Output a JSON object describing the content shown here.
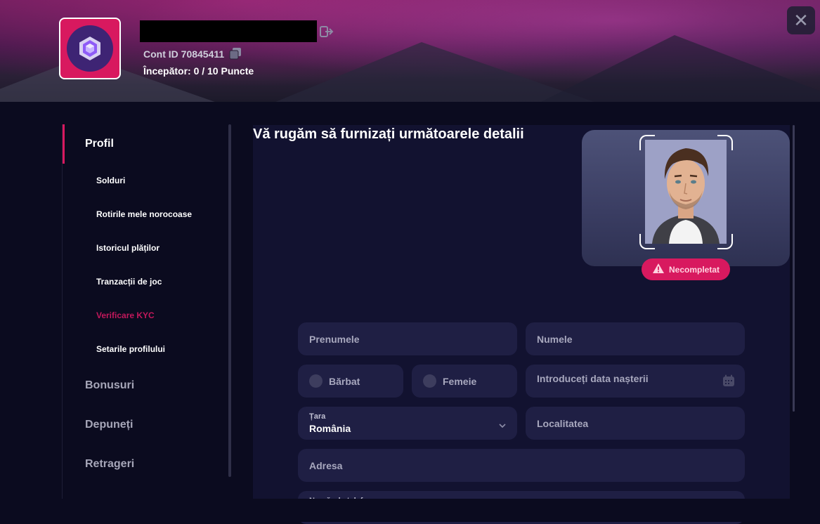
{
  "header": {
    "account_id": "Cont ID 70845411",
    "level_text": "Începător: 0  / 10 Puncte"
  },
  "sidebar": {
    "profile": "Profil",
    "sub_items": [
      {
        "label": "Solduri",
        "active": false
      },
      {
        "label": "Rotirile mele norocoase",
        "active": false
      },
      {
        "label": "Istoricul plăților",
        "active": false
      },
      {
        "label": "Tranzacții de joc",
        "active": false
      },
      {
        "label": "Verificare KYC",
        "active": true
      },
      {
        "label": "Setarile profilului",
        "active": false
      }
    ],
    "sections": [
      "Bonusuri",
      "Depuneți",
      "Retrageri"
    ]
  },
  "content": {
    "title": "Vă rugăm să furnizați următoarele detalii",
    "status_badge": "Necompletat",
    "fields": {
      "first_name_placeholder": "Prenumele",
      "last_name_placeholder": "Numele",
      "gender_male": "Bărbat",
      "gender_female": "Femeie",
      "birthdate_placeholder": "Introduceți data nașterii",
      "country_label": "Țara",
      "country_value": "România",
      "city_placeholder": "Localitatea",
      "address_placeholder": "Adresa",
      "phone_label": "Număr de telefon"
    }
  },
  "colors": {
    "accent": "#d8195f",
    "background": "#0b0b1f",
    "panel": "#121230",
    "field": "#1f1f44",
    "kyc_active": "#c2185b"
  },
  "icons": [
    "logout-icon",
    "copy-icon",
    "close-icon",
    "warning-icon",
    "calendar-icon",
    "chevron-down-icon",
    "hexagon-logo-icon"
  ]
}
